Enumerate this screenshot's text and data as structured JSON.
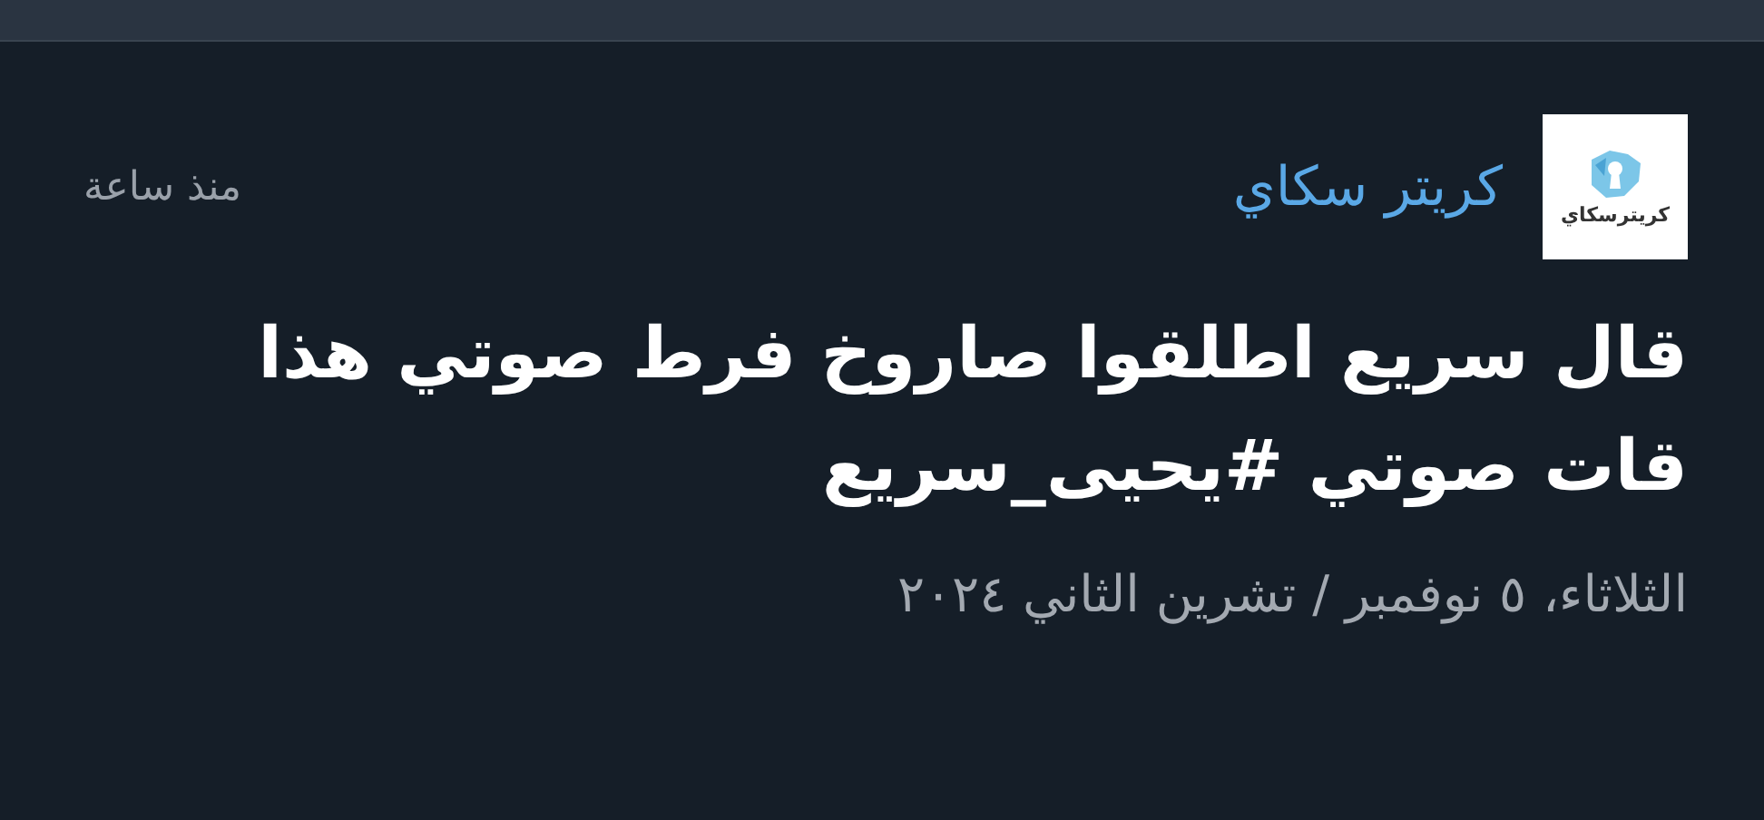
{
  "post": {
    "source": {
      "logo_text": "كريترسكاي",
      "name": "كريتر سكاي"
    },
    "time": "منذ ساعة",
    "headline_lines": [
      "قال سريع اطلقوا صاروخ فرط صوتي هذا",
      "قات صوتي #يحيى_سريع"
    ],
    "date": "الثلاثاء، ٥ نوفمبر / تشرين الثاني ٢٠٢٤"
  }
}
